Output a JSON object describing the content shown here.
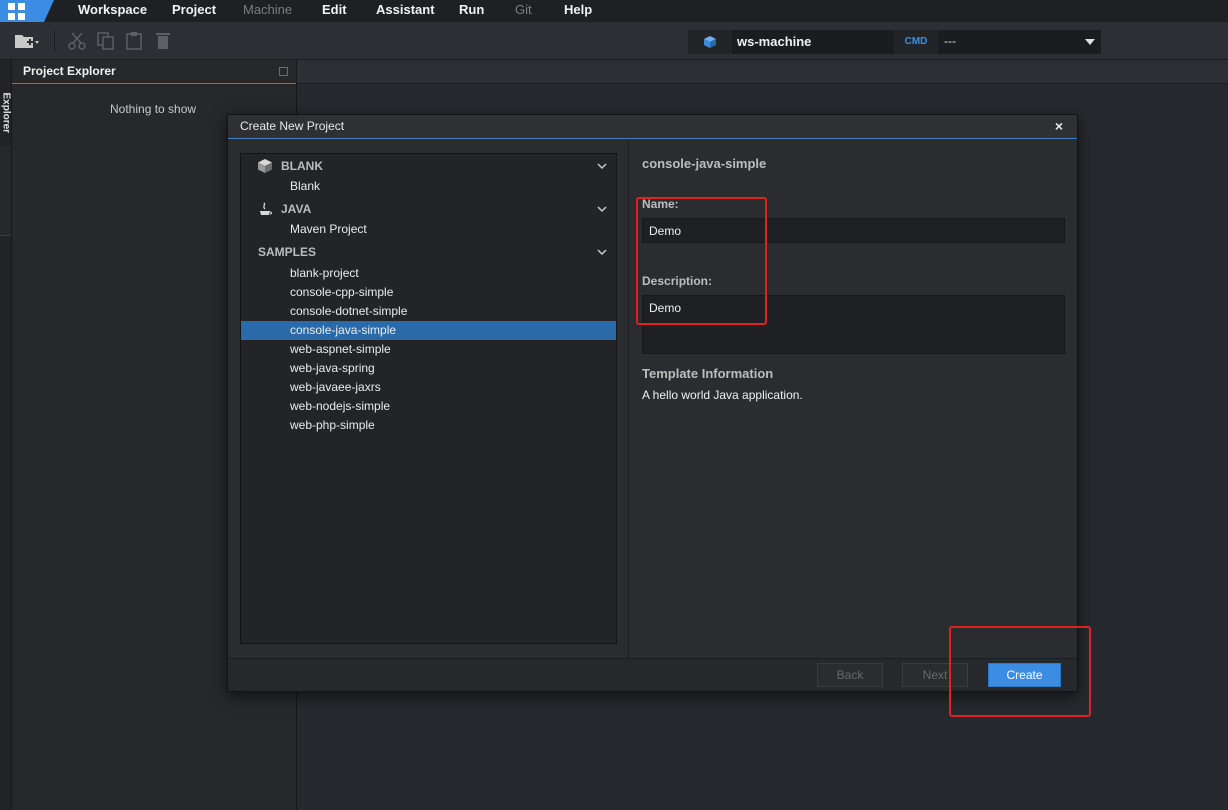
{
  "menubar": {
    "items": [
      {
        "label": "Workspace",
        "enabled": true
      },
      {
        "label": "Project",
        "enabled": true
      },
      {
        "label": "Machine",
        "enabled": false
      },
      {
        "label": "Edit",
        "enabled": true
      },
      {
        "label": "Assistant",
        "enabled": true
      },
      {
        "label": "Run",
        "enabled": true
      },
      {
        "label": "Git",
        "enabled": false
      },
      {
        "label": "Help",
        "enabled": true
      }
    ]
  },
  "toolbar": {
    "machine": "ws-machine",
    "cmd_tag": "CMD",
    "cmd_value": "---"
  },
  "left_strip": {
    "tab": "Explorer"
  },
  "explorer": {
    "title": "Project Explorer",
    "empty": "Nothing to show"
  },
  "dialog": {
    "title": "Create New Project",
    "close": "×",
    "categories": [
      {
        "label": "BLANK",
        "items": [
          "Blank"
        ]
      },
      {
        "label": "JAVA",
        "items": [
          "Maven Project"
        ]
      },
      {
        "label": "SAMPLES",
        "items": [
          "blank-project",
          "console-cpp-simple",
          "console-dotnet-simple",
          "console-java-simple",
          "web-aspnet-simple",
          "web-java-spring",
          "web-javaee-jaxrs",
          "web-nodejs-simple",
          "web-php-simple"
        ]
      }
    ],
    "selected": "console-java-simple",
    "form": {
      "heading": "console-java-simple",
      "name_label": "Name:",
      "name_value": "Demo",
      "desc_label": "Description:",
      "desc_value": "Demo",
      "info_title": "Template Information",
      "info_text": "A hello world Java application."
    },
    "buttons": {
      "back": "Back",
      "next": "Next",
      "create": "Create"
    }
  },
  "colors": {
    "accent": "#3b8de3",
    "selection": "#2a6aa8",
    "annotation": "#e02121"
  }
}
